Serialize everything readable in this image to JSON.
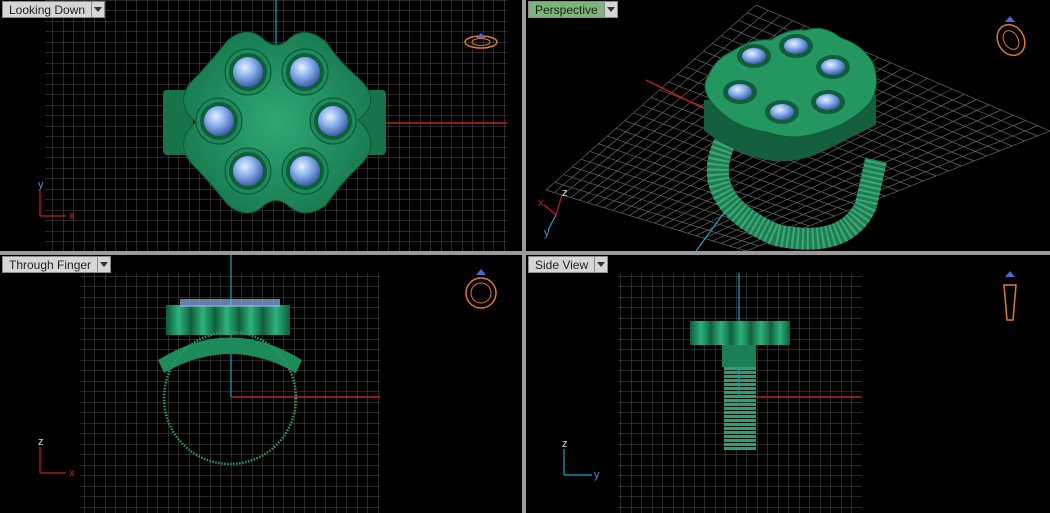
{
  "viewports": [
    {
      "id": "top",
      "label": "Looking Down",
      "active": false,
      "axes": {
        "vertical": "y",
        "horizontal": "x"
      }
    },
    {
      "id": "persp",
      "label": "Perspective",
      "active": true,
      "axes": {
        "vertical": "z",
        "horizontal": "x",
        "third": "y"
      }
    },
    {
      "id": "front",
      "label": "Through Finger",
      "active": false,
      "axes": {
        "vertical": "z",
        "horizontal": "x"
      }
    },
    {
      "id": "side",
      "label": "Side View",
      "active": false,
      "axes": {
        "vertical": "z",
        "horizontal": "y"
      }
    }
  ],
  "colors": {
    "ring_green": "#1f8a5c",
    "ring_dark": "#0e5a3a",
    "gem": "#8fb5ef",
    "grid": "#6d6d6d",
    "axis_x": "#c0201e",
    "axis_z": "#1aa3c4",
    "nav_icon": "#e07a2a"
  }
}
